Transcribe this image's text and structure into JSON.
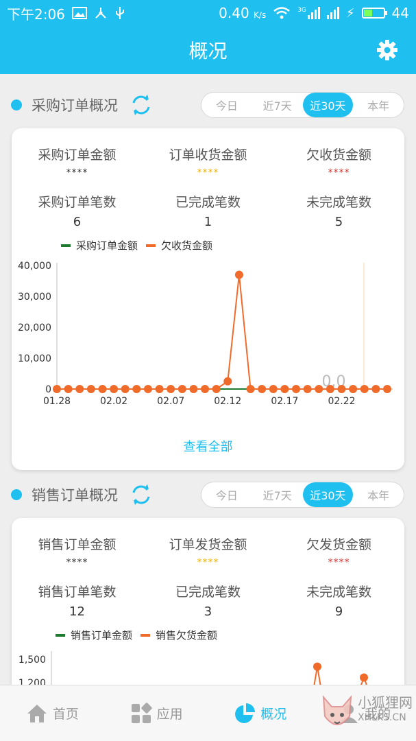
{
  "status_bar": {
    "time": "下午2:06",
    "speed": "0.40",
    "speed_unit": "K/s",
    "network": "3G",
    "battery": "44",
    "battery_level": 0.44
  },
  "app_bar": {
    "title": "概况",
    "settings_icon": "gear-icon"
  },
  "purchase": {
    "title": "概况",
    "section_title": "采购订单概况",
    "range_options": [
      "今日",
      "近7天",
      "近30天",
      "本年"
    ],
    "active_range": "近30天",
    "stats": [
      {
        "label": "采购订单金额",
        "value": "****",
        "color": "#333333"
      },
      {
        "label": "订单收货金额",
        "value": "****",
        "color": "#f0b400"
      },
      {
        "label": "欠收货金额",
        "value": "****",
        "color": "#e03030"
      },
      {
        "label": "采购订单笔数",
        "value": "6",
        "color": "#333333"
      },
      {
        "label": "已完成笔数",
        "value": "1",
        "color": "#333333"
      },
      {
        "label": "未完成笔数",
        "value": "5",
        "color": "#333333"
      }
    ],
    "view_all": "查看全部"
  },
  "sales": {
    "section_title": "销售订单概况",
    "range_options": [
      "今日",
      "近7天",
      "近30天",
      "本年"
    ],
    "active_range": "近30天",
    "stats": [
      {
        "label": "销售订单金额",
        "value": "****",
        "color": "#333333"
      },
      {
        "label": "订单发货金额",
        "value": "****",
        "color": "#f0b400"
      },
      {
        "label": "欠发货金额",
        "value": "****",
        "color": "#e03030"
      },
      {
        "label": "销售订单笔数",
        "value": "12",
        "color": "#333333"
      },
      {
        "label": "已完成笔数",
        "value": "3",
        "color": "#333333"
      },
      {
        "label": "未完成笔数",
        "value": "9",
        "color": "#333333"
      }
    ]
  },
  "chart_data": [
    {
      "type": "line",
      "title": "",
      "legend": [
        "采购订单金额",
        "欠收货金额"
      ],
      "legend_colors": [
        "#1e7a2e",
        "#f06a2a"
      ],
      "xtick_labels": [
        "01.28",
        "02.02",
        "02.07",
        "02.12",
        "02.17",
        "02.22"
      ],
      "yticks": [
        "0",
        "10,000",
        "20,000",
        "30,000",
        "40,000"
      ],
      "ylim": [
        0,
        40000
      ],
      "x": [
        "01.28",
        "01.29",
        "01.30",
        "01.31",
        "02.01",
        "02.02",
        "02.03",
        "02.04",
        "02.05",
        "02.06",
        "02.07",
        "02.08",
        "02.09",
        "02.10",
        "02.11",
        "02.12",
        "02.13",
        "02.14",
        "02.15",
        "02.16",
        "02.17",
        "02.18",
        "02.19",
        "02.20",
        "02.21",
        "02.22",
        "02.23",
        "02.24",
        "02.25",
        "02.26"
      ],
      "series": [
        {
          "name": "采购订单金额",
          "color": "#1e7a2e",
          "values": [
            0,
            0,
            0,
            0,
            0,
            0,
            0,
            0,
            0,
            0,
            0,
            0,
            0,
            0,
            0,
            0,
            0,
            0,
            0,
            0,
            0,
            0,
            0,
            0,
            0,
            0,
            0,
            0,
            0,
            0
          ]
        },
        {
          "name": "欠收货金额",
          "color": "#f06a2a",
          "values": [
            0,
            0,
            0,
            0,
            0,
            0,
            0,
            0,
            0,
            0,
            0,
            0,
            0,
            0,
            0,
            2500,
            37000,
            0,
            0,
            0,
            0,
            0,
            0,
            0,
            0,
            0,
            0,
            0,
            0,
            0
          ]
        }
      ],
      "annotation": "0.0",
      "grid": false
    },
    {
      "type": "line",
      "title": "",
      "legend": [
        "销售订单金额",
        "销售欠货金额"
      ],
      "legend_colors": [
        "#1e7a2e",
        "#f06a2a"
      ],
      "yticks": [
        "1,200",
        "1,500"
      ],
      "ylim": [
        0,
        1500
      ],
      "series": [
        {
          "name": "销售欠货金额",
          "color": "#f06a2a",
          "visible_points": [
            1450,
            1310
          ]
        }
      ],
      "grid": false
    }
  ],
  "bottom_nav": [
    {
      "label": "首页",
      "icon": "home-icon",
      "active": false
    },
    {
      "label": "应用",
      "icon": "apps-grid-icon",
      "active": false
    },
    {
      "label": "概况",
      "icon": "pie-chart-icon",
      "active": true
    },
    {
      "label": "我的",
      "icon": "user-icon",
      "active": false
    }
  ],
  "watermark": {
    "line1": "小狐狸网",
    "line2": "XHLKS.CN"
  }
}
